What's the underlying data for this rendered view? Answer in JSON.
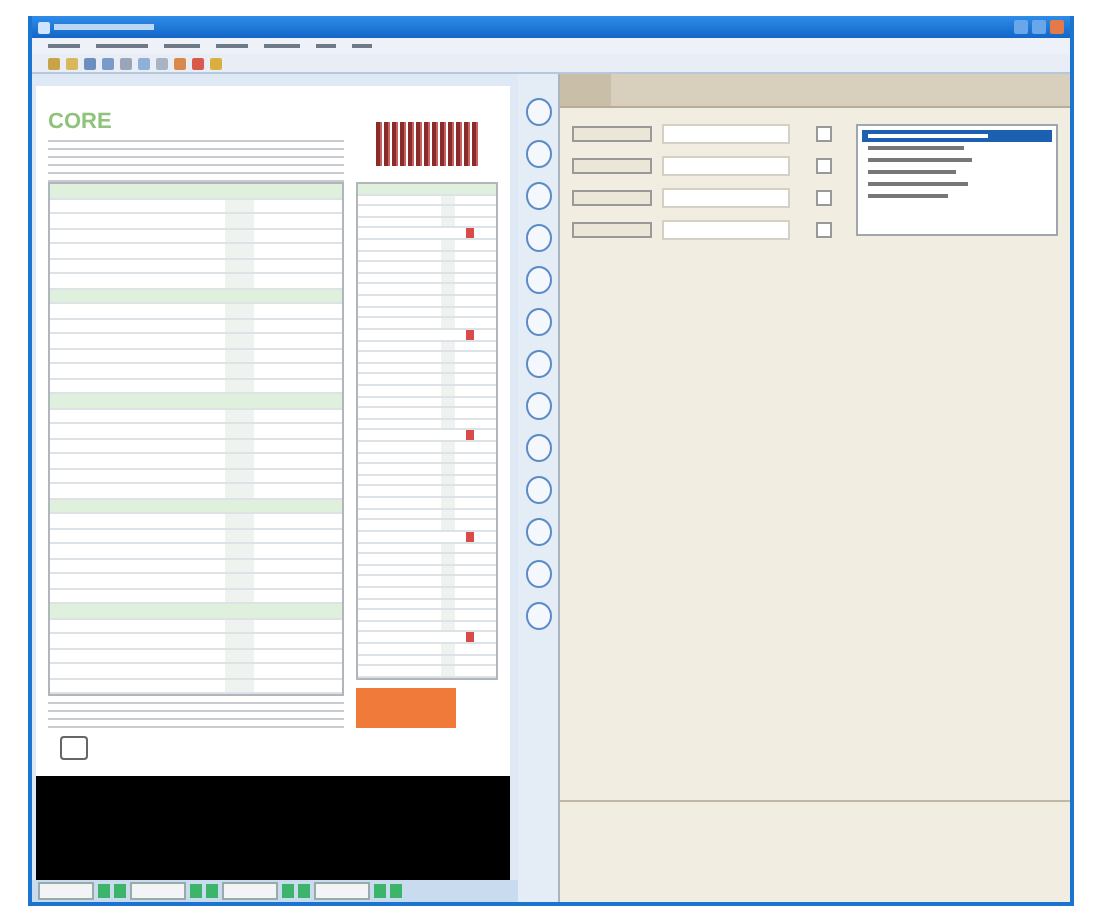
{
  "document": {
    "logo": "CORE"
  },
  "form": {
    "fields": [
      {
        "checked": false
      },
      {
        "checked": false
      },
      {
        "checked": false
      },
      {
        "checked": false
      }
    ]
  },
  "list": {
    "items": [
      {
        "selected": true
      },
      {
        "selected": false
      },
      {
        "selected": false
      },
      {
        "selected": false
      },
      {
        "selected": false
      },
      {
        "selected": false
      }
    ]
  }
}
